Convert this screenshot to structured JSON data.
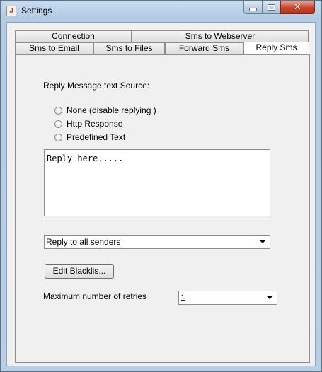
{
  "window": {
    "title": "Settings",
    "app_icon": "java-icon",
    "controls": {
      "minimize": "minimize-icon",
      "maximize": "maximize-icon",
      "close": "close-icon"
    }
  },
  "tabs": {
    "row1": [
      {
        "label": "Connection"
      },
      {
        "label": "Sms to Webserver"
      }
    ],
    "row2": [
      {
        "label": "Sms to Email"
      },
      {
        "label": "Sms to Files"
      },
      {
        "label": "Forward Sms"
      },
      {
        "label": "Reply Sms",
        "selected": true
      }
    ]
  },
  "reply_panel": {
    "source_label": "Reply Message text Source:",
    "radios": [
      {
        "label": "None (disable replying )",
        "checked": false
      },
      {
        "label": "Http Response",
        "checked": false
      },
      {
        "label": "Predefined Text",
        "checked": false
      }
    ],
    "reply_text": "Reply here.....",
    "recipient_combo": {
      "value": "Reply to all senders"
    },
    "edit_blacklist_label": "Edit Blacklis...",
    "retries_label": "Maximum number of retries",
    "retries_combo": {
      "value": "1"
    }
  }
}
